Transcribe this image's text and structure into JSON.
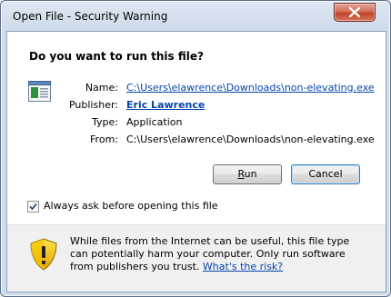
{
  "window": {
    "title": "Open File - Security Warning"
  },
  "dialog": {
    "question": "Do you want to run this file?",
    "fields": {
      "name_label": "Name:",
      "name_value": "C:\\Users\\elawrence\\Downloads\\non-elevating.exe",
      "publisher_label": "Publisher:",
      "publisher_value": "Eric Lawrence",
      "type_label": "Type:",
      "type_value": "Application",
      "from_label": "From:",
      "from_value": "C:\\Users\\elawrence\\Downloads\\non-elevating.exe"
    },
    "buttons": {
      "run": "Run",
      "cancel": "Cancel"
    },
    "checkbox": {
      "label": "Always ask before opening this file",
      "checked": true
    },
    "warning": {
      "text": "While files from the Internet can be useful, this file type can potentially harm your computer. Only run software from publishers you trust. ",
      "link": "What's the risk?"
    }
  },
  "colors": {
    "link": "#0645ad",
    "close_button": "#c0432c",
    "shield_yellow": "#f2c200"
  },
  "icons": {
    "file": "application-file-icon",
    "shield": "security-shield-icon",
    "close": "close-icon",
    "check": "check-icon"
  }
}
